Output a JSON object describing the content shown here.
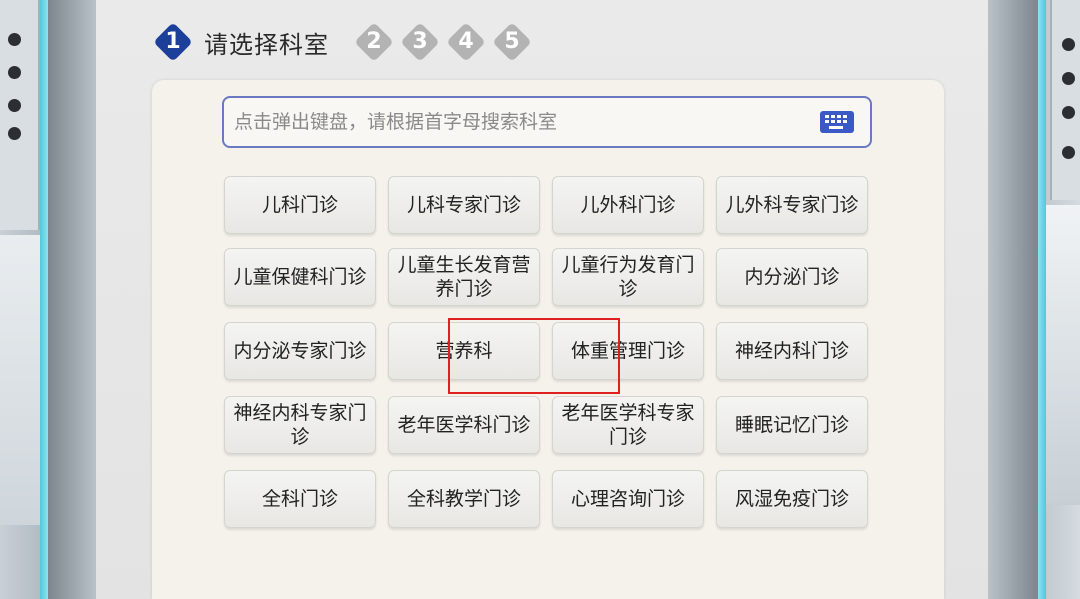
{
  "steps": [
    {
      "number": "1",
      "label": "请选择科室",
      "active": true
    },
    {
      "number": "2",
      "active": false
    },
    {
      "number": "3",
      "active": false
    },
    {
      "number": "4",
      "active": false
    },
    {
      "number": "5",
      "active": false
    }
  ],
  "search": {
    "placeholder": "点击弹出键盘，请根据首字母搜索科室",
    "keyboard_icon": "keyboard-icon"
  },
  "departments": [
    "儿科门诊",
    "儿科专家门诊",
    "儿外科门诊",
    "儿外科专家门诊",
    "儿童保健科门诊",
    "儿童生长发育营养门诊",
    "儿童行为发育门诊",
    "内分泌门诊",
    "内分泌专家门诊",
    "营养科",
    "体重管理门诊",
    "神经内科门诊",
    "神经内科专家门诊",
    "老年医学科门诊",
    "老年医学科专家门诊",
    "睡眠记忆门诊",
    "全科门诊",
    "全科教学门诊",
    "心理咨询门诊",
    "风湿免疫门诊"
  ],
  "highlighted_department": "体重管理门诊",
  "colors": {
    "accent": "#1c3f9a",
    "step_inactive": "#b3b3b3",
    "search_border": "#6a79c0",
    "highlight": "#e02020",
    "kiosk_trim": "#4fc9da"
  }
}
